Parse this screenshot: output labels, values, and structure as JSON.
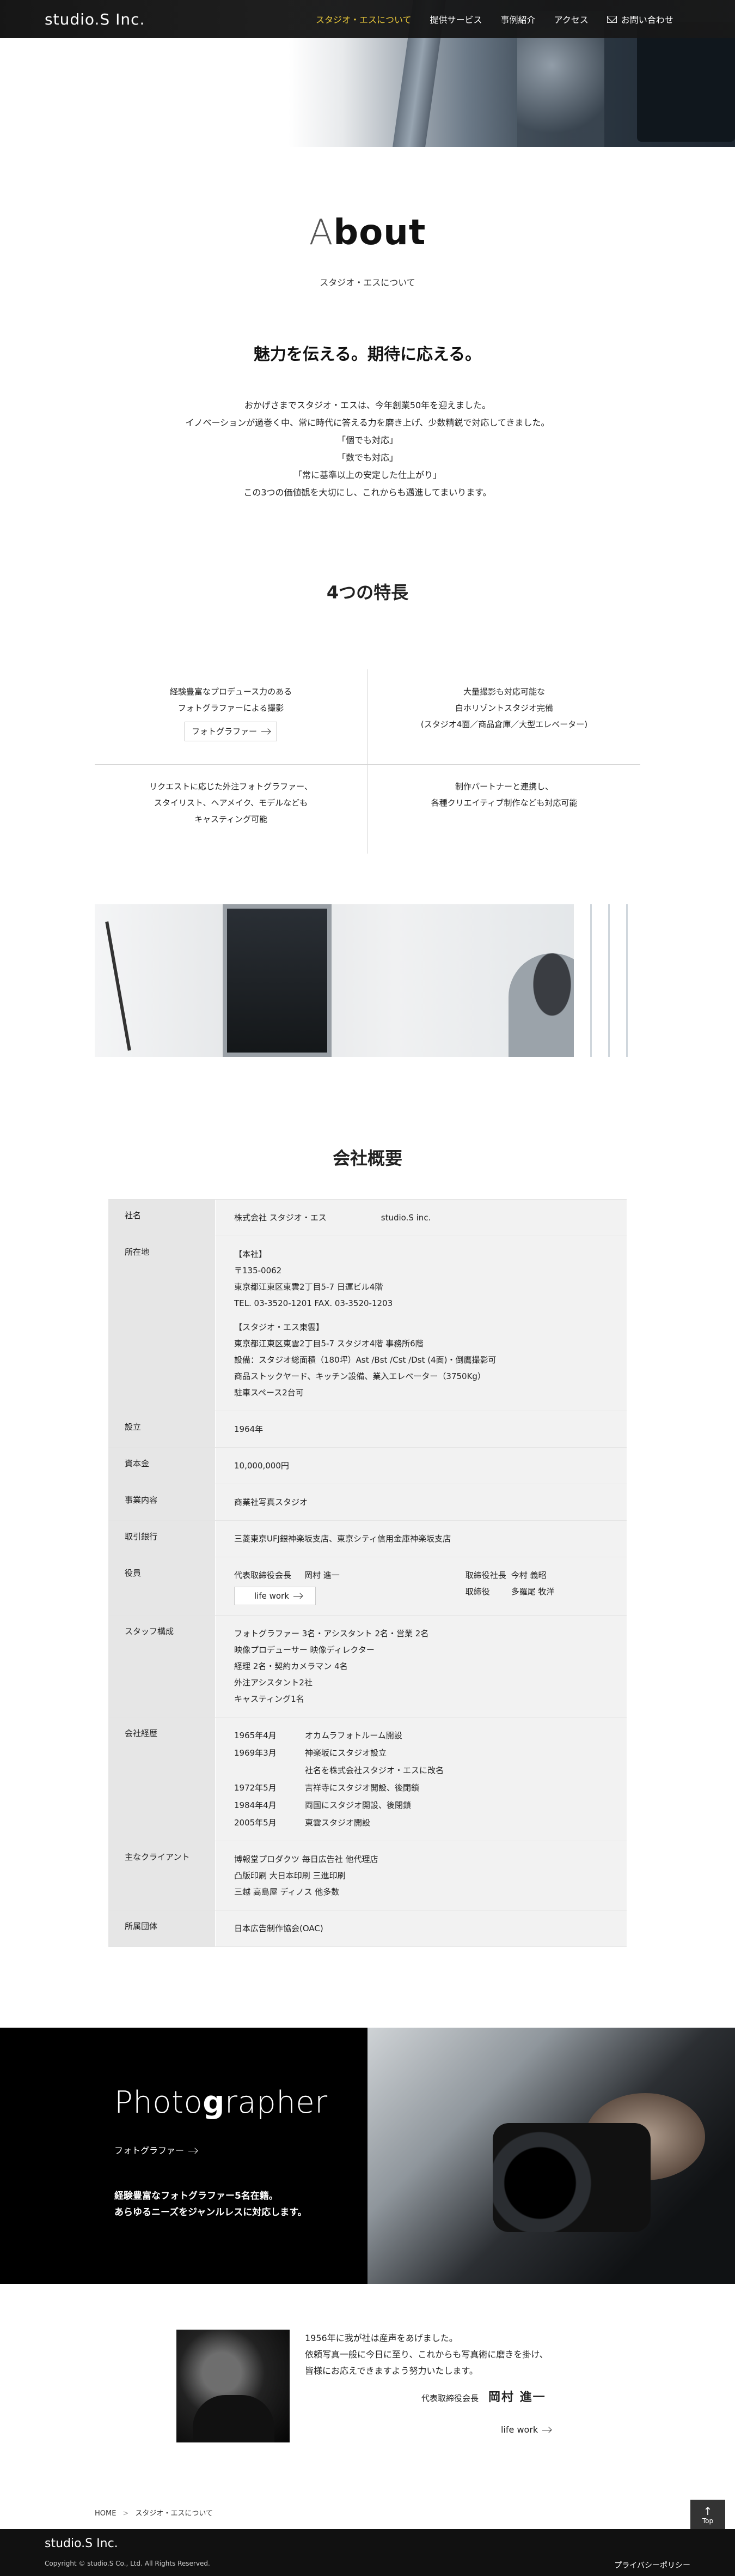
{
  "header": {
    "logo": "studio.S Inc.",
    "nav": [
      {
        "label": "スタジオ・エスについて",
        "active": true
      },
      {
        "label": "提供サービス"
      },
      {
        "label": "事例紹介"
      },
      {
        "label": "アクセス"
      },
      {
        "label": "お問い合わせ",
        "icon": "mail-icon"
      }
    ]
  },
  "about": {
    "title_pre": "A",
    "title_bold": "bout",
    "title_post": "",
    "subtitle": "スタジオ・エスについて",
    "lead": "魅力を伝える。期待に応える。",
    "intro": [
      "おかげさまでスタジオ・エスは、今年創業50年を迎えました。",
      "イノベーションが過巻く中、常に時代に答える力を磨き上げ、少数精鋭で対応してきました。",
      "「個でも対応」",
      "「数でも対応」",
      "「常に基準以上の安定した仕上がり」",
      "この3つの価値観を大切にし、これからも邁進してまいります。"
    ]
  },
  "features": {
    "title": "4つの特長",
    "items": [
      {
        "lines": [
          "経験豊富なプロデュース力のある",
          "フォトグラファーによる撮影"
        ],
        "button": "フォトグラファー"
      },
      {
        "lines": [
          "大量撮影も対応可能な",
          "白ホリゾントスタジオ完備",
          "(スタジオ4面／商品倉庫／大型エレベーター)"
        ]
      },
      {
        "lines": [
          "リクエストに応じた外注フォトグラファー、",
          "スタイリスト、ヘアメイク、モデルなども",
          "キャスティング可能"
        ]
      },
      {
        "lines": [
          "制作パートナーと連携し、",
          "各種クリエイティブ制作なども対応可能"
        ]
      }
    ]
  },
  "company": {
    "title": "会社概要",
    "name_label": "社名",
    "name_ja": "株式会社 スタジオ・エス",
    "name_en": "studio.S inc.",
    "address_label": "所在地",
    "address": [
      "【本社】",
      "〒135-0062",
      "東京都江東区東雲2丁目5-7 日運ビル4階",
      "TEL. 03-3520-1201  FAX. 03-3520-1203",
      "",
      "【スタジオ・エス東雲】",
      "東京都江東区東雲2丁目5-7 スタジオ4階 事務所6階",
      "設備：スタジオ総面積（180坪）Ast /Bst /Cst /Dst (4面)・倒鷹撮影可",
      "商品ストックヤード、キッチン設備、業入エレベーター（3750Kg）",
      "駐車スペース2台可"
    ],
    "founded_label": "設立",
    "founded": "1964年",
    "capital_label": "資本金",
    "capital": "10,000,000円",
    "business_label": "事業内容",
    "business": "商業社写真スタジオ",
    "bank_label": "取引銀行",
    "bank": "三菱東京UFJ銀神楽坂支店、東京シティ信用金庫神楽坂支店",
    "officers_label": "役員",
    "officers_left": [
      {
        "role": "代表取締役会長",
        "name": "岡村 進一"
      }
    ],
    "officers_right": [
      {
        "role": "取締役社長",
        "name": "今村 義昭"
      },
      {
        "role": "取締役",
        "name": "多羅尾 牧洋"
      }
    ],
    "life_work": "life work",
    "staff_label": "スタッフ構成",
    "staff": [
      "フォトグラファー 3名・アシスタント 2名・営業 2名",
      "映像プロデューサー 映像ディレクター",
      "経理 2名・契約カメラマン 4名",
      "外注アシスタント2社",
      "キャスティング1名"
    ],
    "history_label": "会社経歴",
    "history": [
      {
        "date": "1965年4月",
        "text": "オカムラフォトルーム開設"
      },
      {
        "date": "1969年3月",
        "text": "神楽坂にスタジオ設立"
      },
      {
        "date": "",
        "text": "社名を株式会社スタジオ・エスに改名"
      },
      {
        "date": "1972年5月",
        "text": "吉祥寺にスタジオ開設、後閉鎖"
      },
      {
        "date": "1984年4月",
        "text": "両国にスタジオ開設、後閉鎖"
      },
      {
        "date": "2005年5月",
        "text": "東雲スタジオ開設"
      }
    ],
    "clients_label": "主なクライアント",
    "clients": [
      "博報堂プロダクツ 毎日広告社 他代理店",
      "凸版印刷 大日本印刷 三進印刷",
      "三越 高島屋 ディノス 他多数"
    ],
    "org_label": "所属団体",
    "org": "日本広告制作協会(OAC)"
  },
  "photographer": {
    "title_pre": "Photo",
    "title_bold": "g",
    "title_post": "rapher",
    "link": "フォトグラファー",
    "text": [
      "経験豊富なフォトグラファー5名在籍。",
      "あらゆるニーズをジャンルレスに対応します。"
    ]
  },
  "message": {
    "lines": [
      "1956年に我が社は産声をあげました。",
      "依頼写真一般に今日に至り、これからも写真術に磨きを掛け、",
      "皆様にお応えできますよう努力いたします。"
    ],
    "role": "代表取締役会長",
    "name": "岡村 進一",
    "link": "life work"
  },
  "breadcrumb": {
    "home": "HOME",
    "current": "スタジオ・エスについて"
  },
  "footer": {
    "logo": "studio.S Inc.",
    "copyright": "Copyright © studio.S Co., Ltd. All Rights Reserved.",
    "privacy": "プライバシーポリシー",
    "totop": "Top"
  }
}
